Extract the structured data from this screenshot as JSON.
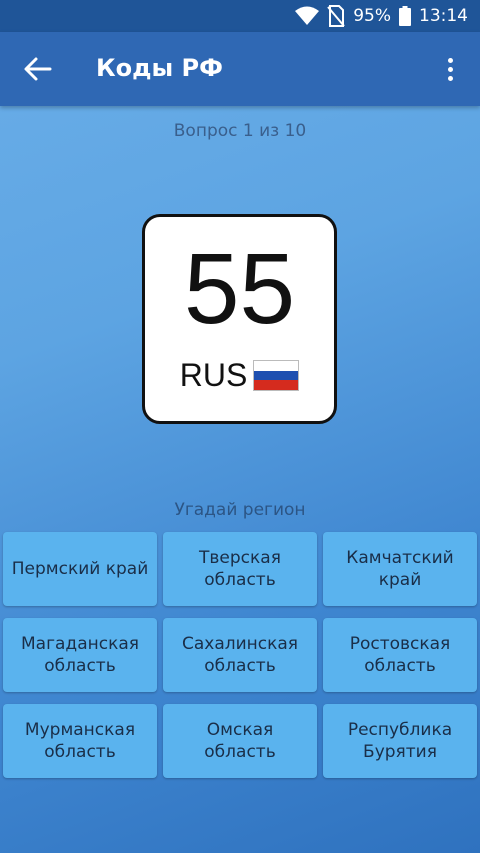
{
  "status_bar": {
    "battery": "95%",
    "time": "13:14"
  },
  "app_bar": {
    "title": "Коды РФ"
  },
  "quiz": {
    "counter": "Вопрос 1 из 10",
    "plate_code": "55",
    "plate_country": "RUS",
    "prompt": "Угадай регион"
  },
  "answers": [
    "Пермский край",
    "Тверская область",
    "Камчатский край",
    "Магаданская область",
    "Сахалинская область",
    "Ростовская область",
    "Мурманская область",
    "Омская область",
    "Республика Бурятия"
  ],
  "colors": {
    "status_bar": "#1f5598",
    "app_bar": "#2f68b4",
    "answer_button": "#5ab3ee",
    "flag_white": "#ffffff",
    "flag_blue": "#1e4fb0",
    "flag_red": "#d52b1e"
  },
  "icons": [
    "wifi-icon",
    "no-sim-icon",
    "battery-icon",
    "back-arrow-icon",
    "more-vert-icon"
  ]
}
